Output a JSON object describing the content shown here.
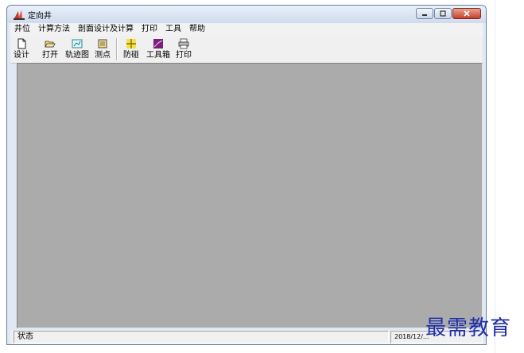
{
  "window": {
    "title": "定向井"
  },
  "menu": {
    "items": [
      "井位",
      "计算方法",
      "剖面设计及计算",
      "打印",
      "工具",
      "帮助"
    ]
  },
  "toolbar": {
    "buttons": [
      {
        "label": "设计",
        "icon": "new-document-icon"
      },
      {
        "label": "打开",
        "icon": "open-folder-icon"
      },
      {
        "label": "轨迹图",
        "icon": "trajectory-chart-icon"
      },
      {
        "label": "测点",
        "icon": "survey-points-icon"
      },
      {
        "label": "防碰",
        "icon": "anti-collision-icon"
      },
      {
        "label": "工具箱",
        "icon": "toolbox-icon"
      },
      {
        "label": "打印",
        "icon": "printer-icon"
      }
    ]
  },
  "status": {
    "text": "状态",
    "date": "2018/12/..."
  },
  "watermark": {
    "text": "最需教育"
  },
  "colors": {
    "client_area": "#ababab",
    "title_bar": "#dfe8f4",
    "close_button": "#c4412b",
    "watermark": "#1f2fa8"
  }
}
